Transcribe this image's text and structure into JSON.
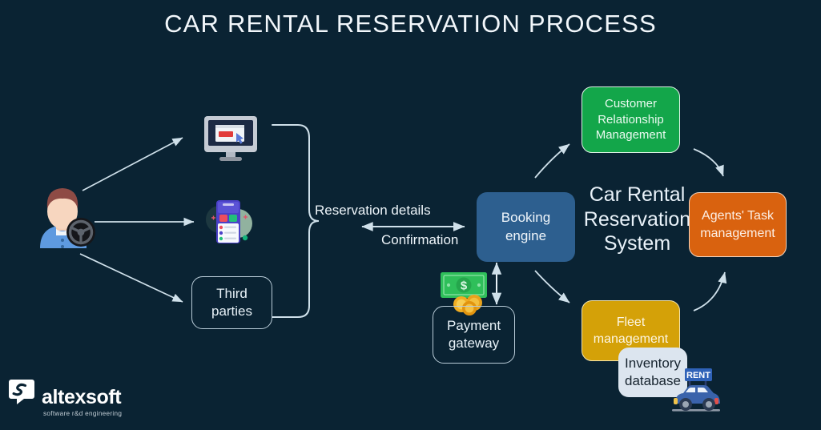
{
  "page": {
    "title": "CAR RENTAL RESERVATION PROCESS",
    "background_color": "#0a2333"
  },
  "actors": {
    "customer": {
      "icon": "driver-avatar-icon",
      "label": ""
    }
  },
  "channels": [
    {
      "id": "website",
      "icon": "desktop-monitor-icon",
      "label": ""
    },
    {
      "id": "mobile-app",
      "icon": "mobile-phone-app-icon",
      "label": ""
    },
    {
      "id": "third-parties",
      "icon": "",
      "label": "Third parties",
      "style": "outline"
    }
  ],
  "flows": {
    "outbound_label": "Reservation details",
    "inbound_label": "Confirmation"
  },
  "system": {
    "caption": "Car Rental\nReservation\nSystem",
    "booking_engine": {
      "label": "Booking\nengine",
      "color": "#2d5f8f"
    },
    "payment_gateway": {
      "label": "Payment\ngateway",
      "icon": "money-cash-coins-icon",
      "style": "outline"
    },
    "modules": [
      {
        "id": "crm",
        "label": "Customer\nRelationship\nManagement",
        "color": "#13a64a"
      },
      {
        "id": "agents",
        "label": "Agents' Task\nmanagement",
        "color": "#d9620f"
      },
      {
        "id": "fleet",
        "label": "Fleet\nmanagement",
        "color": "#d4a108"
      },
      {
        "id": "inventory",
        "label": "Inventory\ndatabase",
        "color": "#dce5ef"
      }
    ],
    "car_icon": {
      "name": "rental-car-icon",
      "sign_text": "RENT"
    }
  },
  "branding": {
    "name": "altexsoft",
    "tagline": "software r&d engineering",
    "mark": "altexsoft-logo-mark"
  }
}
